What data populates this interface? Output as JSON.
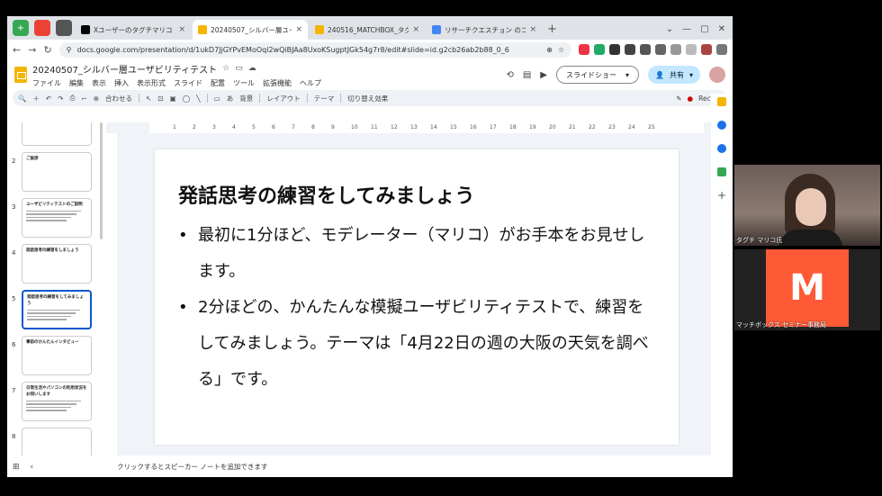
{
  "tabs": [
    {
      "label": "Xユーザーのタグチマリコ | 日本",
      "close": "×"
    },
    {
      "label": "20240507_シルバー層ユーザビ",
      "close": "×"
    },
    {
      "label": "240516_MATCHBOX_タグチ",
      "close": "×"
    },
    {
      "label": "リサーチクエスチョン のコピー",
      "close": "×"
    }
  ],
  "new_tab": "+",
  "url": "docs.google.com/presentation/d/1ukD7JjGYPvEMoOql2wQiBJAa8UxoKSugptJGk54g7r8/edit#slide=id.g2cb26ab2b88_0_6",
  "doc": {
    "title": "20240507_シルバー層ユーザビリティテスト",
    "menus": [
      "ファイル",
      "編集",
      "表示",
      "挿入",
      "表示形式",
      "スライド",
      "配置",
      "ツール",
      "拡張機能",
      "ヘルプ"
    ],
    "slideshow_label": "スライドショー",
    "share_label": "共有"
  },
  "edit_toolbar": {
    "zoom": "合わせる",
    "bg": "背景",
    "layout": "レイアウト",
    "theme": "テーマ",
    "transition": "切り替え効果",
    "rec": "Rec"
  },
  "ruler_ticks": [
    "1",
    "2",
    "3",
    "4",
    "5",
    "6",
    "7",
    "8",
    "9",
    "10",
    "11",
    "12",
    "13",
    "14",
    "15",
    "16",
    "17",
    "18",
    "19",
    "20",
    "21",
    "22",
    "23",
    "24",
    "25"
  ],
  "thumbnails": [
    {
      "num": "",
      "title": "ユーザビリティテスト",
      "lines": 1,
      "selected": false
    },
    {
      "num": "2",
      "title": "ご挨拶",
      "lines": 0,
      "selected": false
    },
    {
      "num": "3",
      "title": "ユーザビリティテストのご説明",
      "lines": 4,
      "selected": false
    },
    {
      "num": "4",
      "title": "発話思考の練習をしましょう",
      "lines": 0,
      "selected": false
    },
    {
      "num": "5",
      "title": "発話思考の練習をしてみましょう",
      "lines": 4,
      "selected": true
    },
    {
      "num": "6",
      "title": "事前のかんたんインタビュー",
      "lines": 0,
      "selected": false
    },
    {
      "num": "7",
      "title": "日常生活やパソコンの利用状況をお伺いします",
      "lines": 4,
      "selected": false
    },
    {
      "num": "8",
      "title": "",
      "lines": 0,
      "selected": false
    }
  ],
  "slide": {
    "title": "発話思考の練習をしてみましょう",
    "bullets": [
      "最初に1分ほど、モデレーター（マリコ）がお手本をお見せします。",
      "2分ほどの、かんたんな模擬ユーザビリティテストで、練習をしてみましょう。テーマは「4月22日の週の大阪の天気を調べる」です。"
    ]
  },
  "notes_placeholder": "クリックするとスピーカー ノートを追加できます",
  "participants": [
    {
      "name": "タグチ マリコ氏"
    },
    {
      "name": "マッチボックス セミナー事務局",
      "logo": "M"
    }
  ],
  "colors": {
    "accent": "#0b57d0",
    "matchbox": "#ff5a36",
    "slides_yellow": "#f4b400"
  }
}
